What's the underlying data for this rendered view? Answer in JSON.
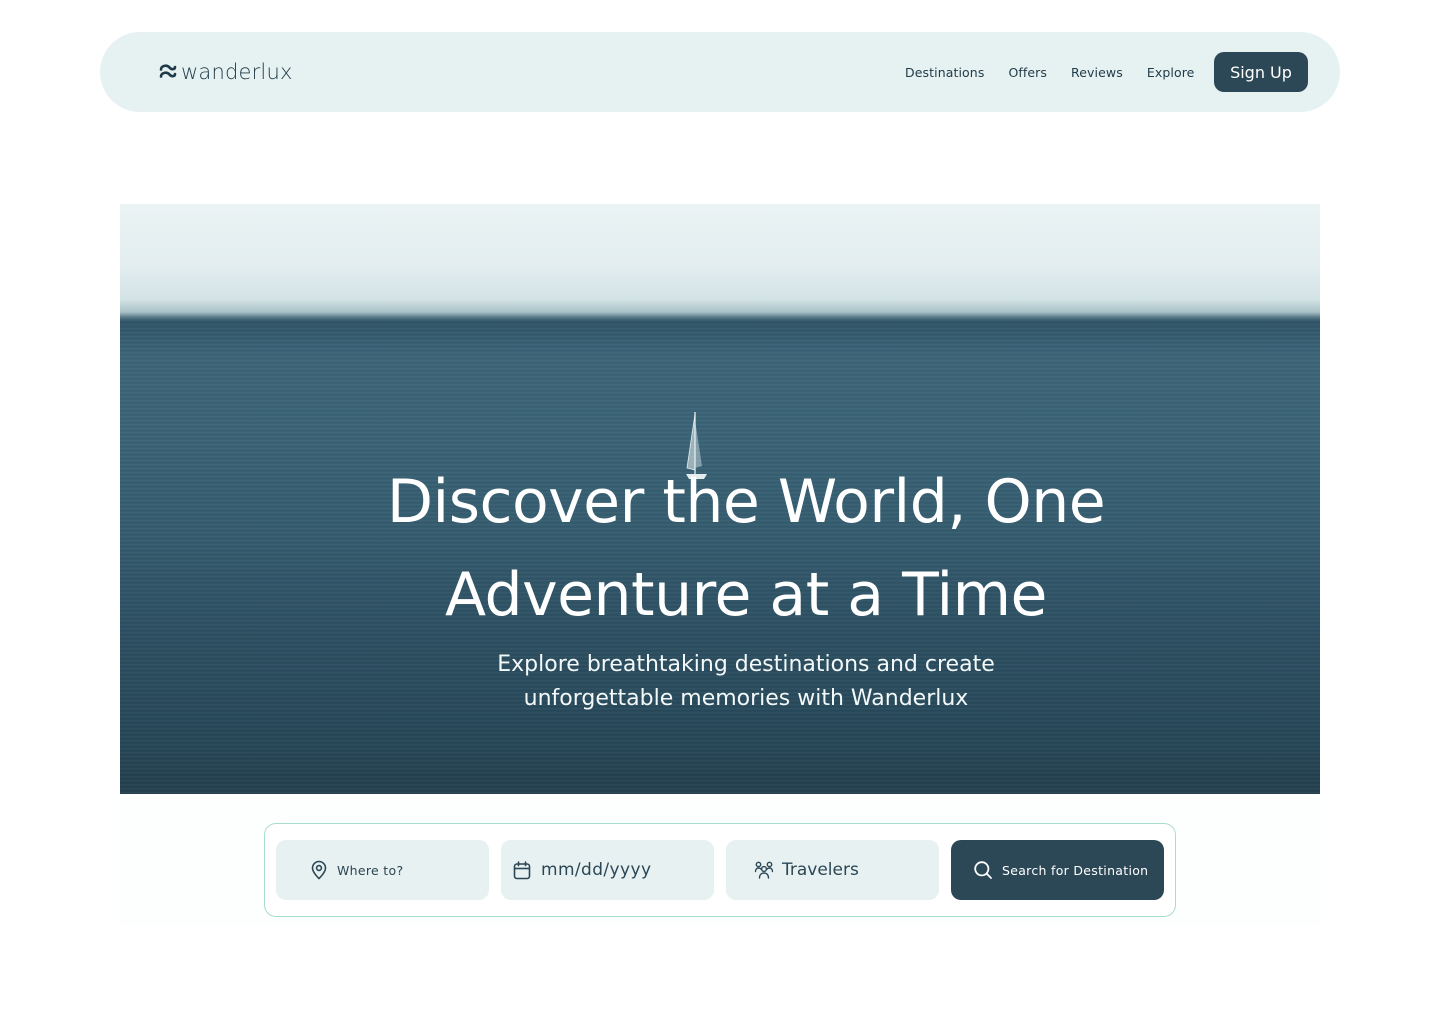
{
  "brand": {
    "name": "wanderlux"
  },
  "nav": {
    "links": [
      {
        "label": "Destinations"
      },
      {
        "label": "Offers"
      },
      {
        "label": "Reviews"
      },
      {
        "label": "Explore"
      }
    ],
    "signup_label": "Sign Up"
  },
  "hero": {
    "title_line1": "Discover the World, One",
    "title_line2": "Adventure at a Time",
    "subtitle_line1": "Explore breathtaking destinations and create",
    "subtitle_line2": "unforgettable memories with Wanderlux"
  },
  "search": {
    "where_placeholder": "Where to?",
    "date_placeholder": "mm/dd/yyyy",
    "travelers_label": "Travelers",
    "button_label": "Search for Destination",
    "icons": {
      "where": "location-pin-icon",
      "date": "calendar-icon",
      "travelers": "travelers-group-icon",
      "button": "search-icon"
    }
  },
  "colors": {
    "accent": "#2c4857",
    "nav_background": "#e6f1f1",
    "field_background": "#e7f1f1",
    "search_border": "#a9dcd0"
  }
}
